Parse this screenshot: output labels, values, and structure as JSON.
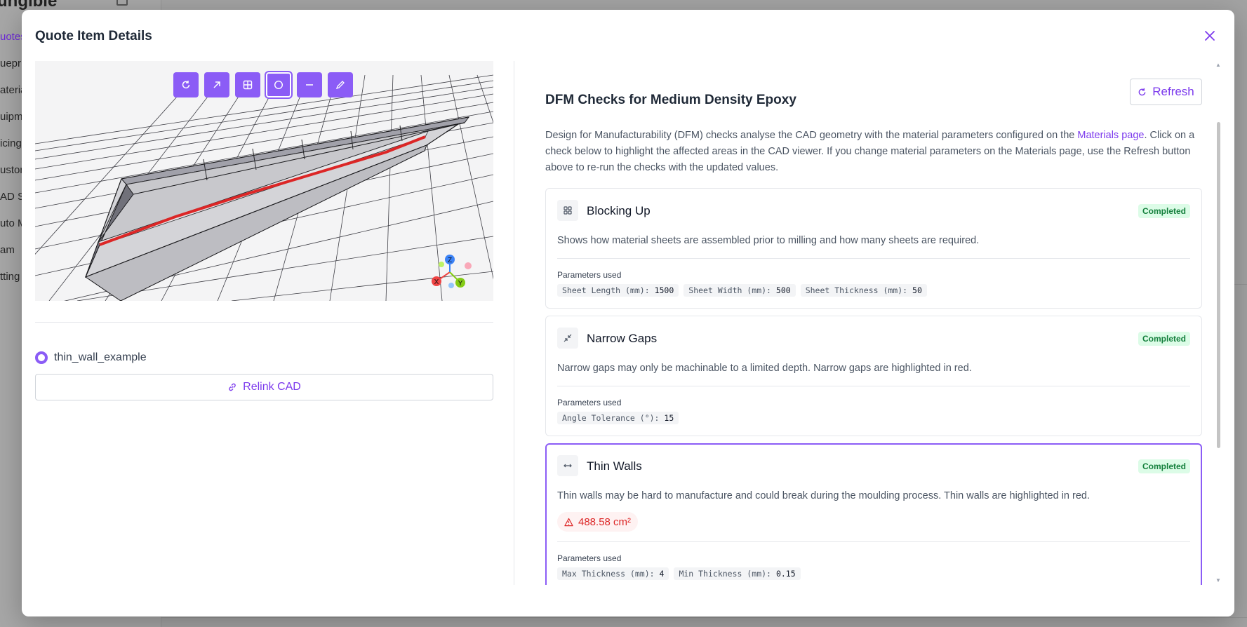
{
  "background": {
    "logo": "ungible",
    "nav": [
      {
        "label": "uotes",
        "active": true
      },
      {
        "label": "uepri",
        "active": false
      },
      {
        "label": "ateria",
        "active": false
      },
      {
        "label": "uipm",
        "active": false
      },
      {
        "label": "icing",
        "active": false
      },
      {
        "label": "ustom",
        "active": false
      },
      {
        "label": "AD St",
        "active": false
      },
      {
        "label": "uto M",
        "active": false
      },
      {
        "label": "am",
        "active": false
      },
      {
        "label": "tting",
        "active": false
      }
    ]
  },
  "modal": {
    "title": "Quote Item Details",
    "close_icon": "close-icon"
  },
  "viewer": {
    "tools": [
      {
        "name": "rotate-tool",
        "icon": "rotate-icon",
        "active": false
      },
      {
        "name": "arrow-tool",
        "icon": "arrow-up-right-icon",
        "active": false
      },
      {
        "name": "grid-tool",
        "icon": "grid-icon",
        "active": false
      },
      {
        "name": "circle-tool",
        "icon": "circle-icon",
        "active": true
      },
      {
        "name": "minus-tool",
        "icon": "minus-icon",
        "active": false
      },
      {
        "name": "pencil-tool",
        "icon": "pencil-icon",
        "active": false
      }
    ],
    "axes": {
      "x": "X",
      "y": "Y",
      "z": "Z"
    }
  },
  "cad": {
    "name": "thin_wall_example",
    "relink_label": "Relink CAD"
  },
  "dfm": {
    "title": "DFM Checks for Medium Density Epoxy",
    "refresh_label": "Refresh",
    "description_pre": "Design for Manufacturability (DFM) checks analyse the CAD geometry with the material parameters configured on the ",
    "description_link": "Materials page",
    "description_post": ". Click on a check below to highlight the affected areas in the CAD viewer. If you change material parameters on the Materials page, use the Refresh button above to re-run the checks with the updated values.",
    "checks": [
      {
        "title": "Blocking Up",
        "icon": "blocks-icon",
        "status": "Completed",
        "description": "Shows how material sheets are assembled prior to milling and how many sheets are required.",
        "params_label": "Parameters used",
        "params": [
          {
            "key": "Sheet Length (mm):",
            "value": "1500"
          },
          {
            "key": "Sheet Width (mm):",
            "value": "500"
          },
          {
            "key": "Sheet Thickness (mm):",
            "value": "50"
          }
        ]
      },
      {
        "title": "Narrow Gaps",
        "icon": "shrink-icon",
        "status": "Completed",
        "description": "Narrow gaps may only be machinable to a limited depth. Narrow gaps are highlighted in red.",
        "params_label": "Parameters used",
        "params": [
          {
            "key": "Angle Tolerance (°):",
            "value": "15"
          }
        ]
      },
      {
        "title": "Thin Walls",
        "icon": "horizontal-arrows-icon",
        "status": "Completed",
        "description": "Thin walls may be hard to manufacture and could break during the moulding process. Thin walls are highlighted in red.",
        "warning": "488.58 cm²",
        "params_label": "Parameters used",
        "params": [
          {
            "key": "Max Thickness (mm):",
            "value": "4"
          },
          {
            "key": "Min Thickness (mm):",
            "value": "0.15"
          }
        ]
      }
    ]
  },
  "colors": {
    "accent": "#8b5cf6",
    "accent_text": "#7c3aed",
    "success_bg": "#dcfce7",
    "success_text": "#15803d",
    "danger": "#dc2626"
  }
}
